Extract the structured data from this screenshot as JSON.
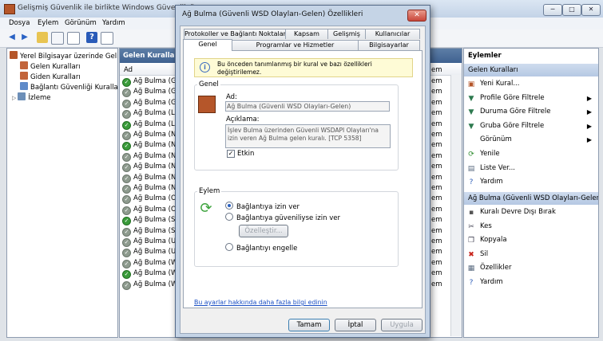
{
  "window": {
    "title": "Gelişmiş Güvenlik ile birlikte Windows Güvenlik Duva",
    "min": "─",
    "max": "□",
    "close": "✕"
  },
  "menu": [
    "Dosya",
    "Eylem",
    "Görünüm",
    "Yardım"
  ],
  "tree": {
    "root": "Yerel Bilgisayar üzerinde Gelişm",
    "items": [
      "Gelen Kuralları",
      "Giden Kuralları",
      "Bağlantı Güvenliği Kuralları",
      "İzleme"
    ]
  },
  "center": {
    "title": "Gelen Kuralları",
    "column": "Ad",
    "right_column": "em",
    "rows": [
      "Ağ Bulma (Güv",
      "Ağ Bulma (Güv",
      "Ağ Bulma (Güv",
      "Ağ Bulma (LLN",
      "Ağ Bulma (LLN",
      "Ağ Bulma (NB",
      "Ağ Bulma (NB",
      "Ağ Bulma (NB",
      "Ağ Bulma (NB",
      "Ağ Bulma (NB",
      "Ağ Bulma (NB",
      "Ağ Bulma (Ort",
      "Ağ Bulma (Ort",
      "Ağ Bulma (SSD",
      "Ağ Bulma (SSD",
      "Ağ Bulma (UPr",
      "Ağ Bulma (UPr",
      "Ağ Bulma (WS",
      "Ağ Bulma (WS",
      "Ağ Bulma (WS"
    ],
    "row_states": [
      true,
      false,
      false,
      false,
      true,
      false,
      true,
      false,
      false,
      false,
      false,
      false,
      false,
      true,
      false,
      false,
      false,
      false,
      true,
      false
    ],
    "right_vals": [
      "em",
      "em",
      "em",
      "em",
      "em",
      "em",
      "em",
      "em",
      "em",
      "em",
      "em",
      "em",
      "em",
      "em",
      "em",
      "em",
      "em",
      "em",
      "em",
      "em"
    ]
  },
  "actions": {
    "header": "Eylemler",
    "section1": "Gelen Kuralları",
    "items1": [
      {
        "label": "Yeni Kural...",
        "icon": "new-rule-icon",
        "arrow": false
      },
      {
        "label": "Profile Göre Filtrele",
        "icon": "filter-icon",
        "arrow": true
      },
      {
        "label": "Duruma Göre Filtrele",
        "icon": "filter-icon",
        "arrow": true
      },
      {
        "label": "Gruba Göre Filtrele",
        "icon": "filter-icon",
        "arrow": true
      },
      {
        "label": "Görünüm",
        "icon": "",
        "arrow": true
      },
      {
        "label": "Yenile",
        "icon": "refresh-icon",
        "arrow": false
      },
      {
        "label": "Liste Ver...",
        "icon": "export-icon",
        "arrow": false
      },
      {
        "label": "Yardım",
        "icon": "help-icon",
        "arrow": false
      }
    ],
    "section2": "Ağ Bulma (Güvenli WSD Olayları-Gelen)",
    "items2": [
      {
        "label": "Kuralı Devre Dışı Bırak",
        "icon": "disable-icon"
      },
      {
        "label": "Kes",
        "icon": "cut-icon"
      },
      {
        "label": "Kopyala",
        "icon": "copy-icon"
      },
      {
        "label": "Sil",
        "icon": "delete-icon"
      },
      {
        "label": "Özellikler",
        "icon": "properties-icon"
      },
      {
        "label": "Yardım",
        "icon": "help-icon"
      }
    ]
  },
  "dialog": {
    "title": "Ağ Bulma (Güvenli WSD Olayları-Gelen) Özellikleri",
    "tabs_row1": [
      "Protokoller ve Bağlantı Noktaları",
      "Kapsam",
      "Gelişmiş",
      "Kullanıcılar"
    ],
    "tabs_row2": [
      "Genel",
      "Programlar ve Hizmetler",
      "Bilgisayarlar"
    ],
    "info": "Bu önceden tanımlanmış bir kural ve bazı özellikleri değiştirilemez.",
    "general_label": "Genel",
    "name_label": "Ad:",
    "name_value": "Ağ Bulma (Güvenli WSD Olayları-Gelen)",
    "desc_label": "Açıklama:",
    "desc_value": "İşlev Bulma üzerinden Güvenli WSDAPI Olayları'na izin veren Ağ Bulma gelen kuralı. [TCP 5358]",
    "enabled_label": "Etkin",
    "action_label": "Eylem",
    "radio_allow": "Bağlantıya izin ver",
    "radio_secure": "Bağlantıya güveniliyse izin ver",
    "customize": "Özelleştir...",
    "radio_block": "Bağlantıyı engelle",
    "learn_more": "Bu ayarlar hakkında daha fazla bilgi edinin",
    "ok": "Tamam",
    "cancel": "İptal",
    "apply": "Uygula"
  }
}
